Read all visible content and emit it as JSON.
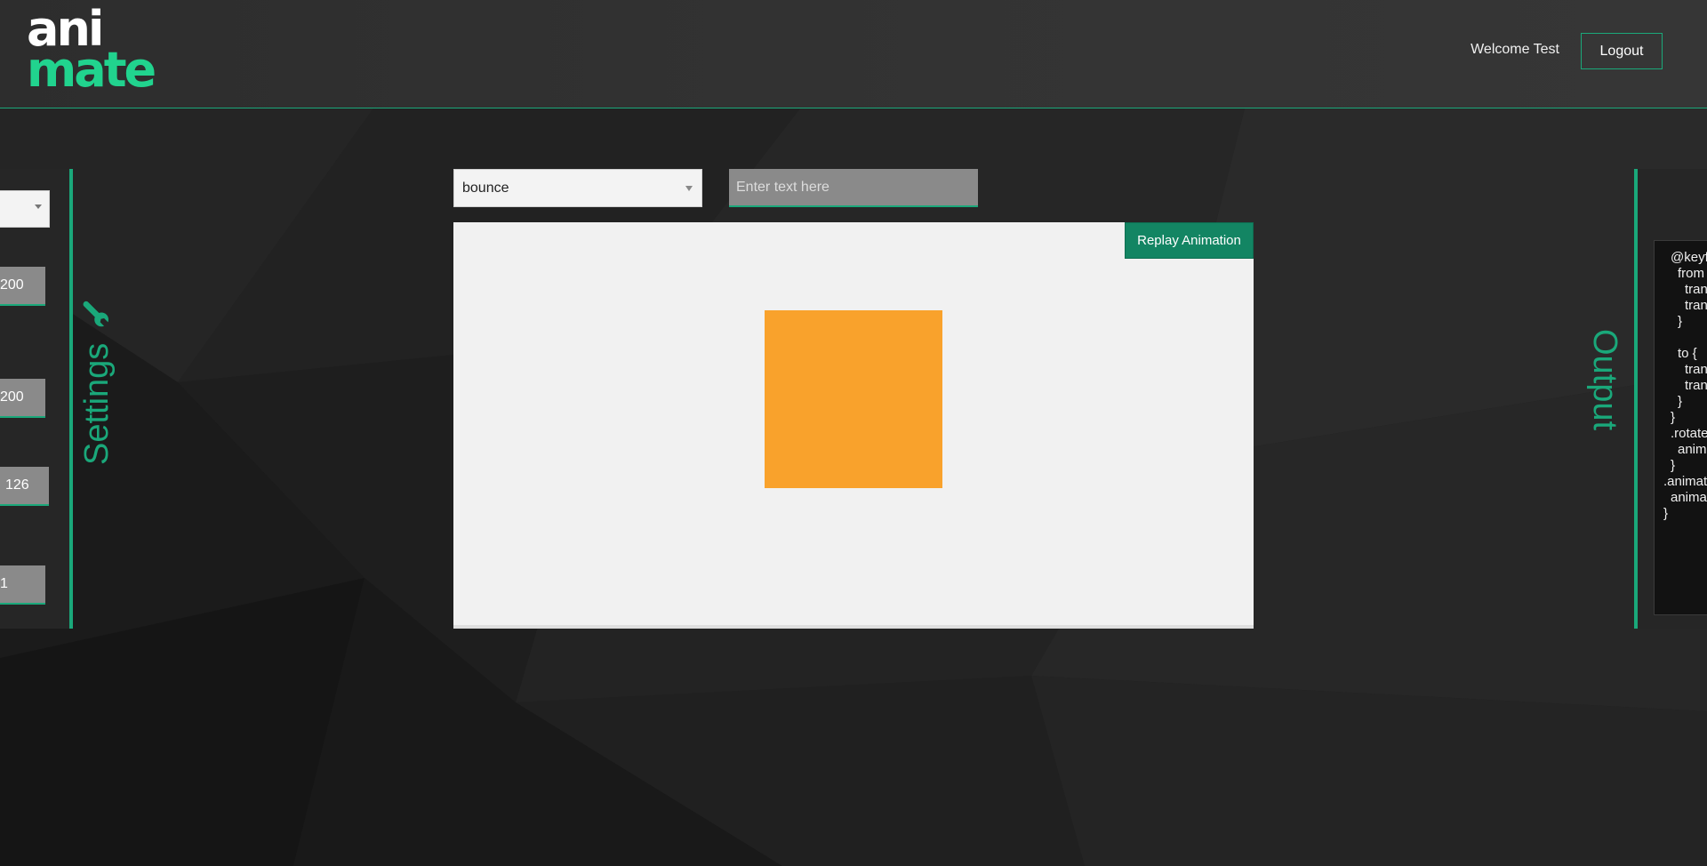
{
  "header": {
    "logo_line1": "ani",
    "logo_line2": "mate",
    "welcome_text": "Welcome Test",
    "logout_label": "Logout"
  },
  "settings": {
    "panel_label": "Settings",
    "select_value": "",
    "fields": [
      "200",
      "200",
      "126",
      "1"
    ]
  },
  "controls": {
    "animation_select_value": "bounce",
    "text_placeholder": "Enter text here"
  },
  "stage": {
    "replay_label": "Replay Animation",
    "box_color": "#f9a22c"
  },
  "output": {
    "panel_label": "Output",
    "code_lines": [
      "@keyf",
      "from",
      "tran",
      "tran",
      "}",
      "to {",
      "tran",
      "tran",
      "}",
      "}",
      ".rotate",
      "anim",
      "}",
      ".animat",
      "animat",
      "}"
    ]
  },
  "colors": {
    "accent": "#1aa87a",
    "background": "#1c1c1c",
    "header": "#333333",
    "logo_green": "#21d38e",
    "button_green": "#138563"
  },
  "icons": {
    "settings_icon": "wrench-icon"
  }
}
